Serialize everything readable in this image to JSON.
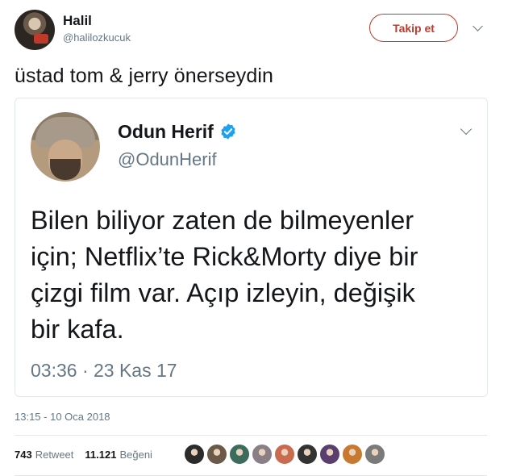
{
  "author": {
    "name": "Halil",
    "handle": "@halilozkucuk"
  },
  "follow_button": {
    "label": "Takip et"
  },
  "tweet": {
    "text": "üstad tom & jerry önerseydin"
  },
  "quoted_tweet": {
    "author_name": "Odun Herif",
    "author_handle": "@OdunHerif",
    "text_lines": [
      "Bilen biliyor zaten de bilmeyenler",
      "için; Netflix’te Rick&Morty diye bir",
      "çizgi film var. Açıp izleyin, değişik",
      "bir kafa."
    ],
    "time": "03:36 · 23 Kas 17"
  },
  "timestamp": "13:15 - 10 Oca 2018",
  "stats": {
    "retweets": "743",
    "retweets_label": "Retweet",
    "likes": "11.121",
    "likes_label": "Beğeni"
  },
  "likers": [
    "#2b2b2b",
    "#6b5a4a",
    "#3d6b5c",
    "#8a7f86",
    "#c96b4e",
    "#333333",
    "#5a3f6e",
    "#c9792f",
    "#7a7a7a"
  ],
  "colors": {
    "follow": "#c0392b",
    "verified": "#1da1f2",
    "muted": "#657786"
  }
}
